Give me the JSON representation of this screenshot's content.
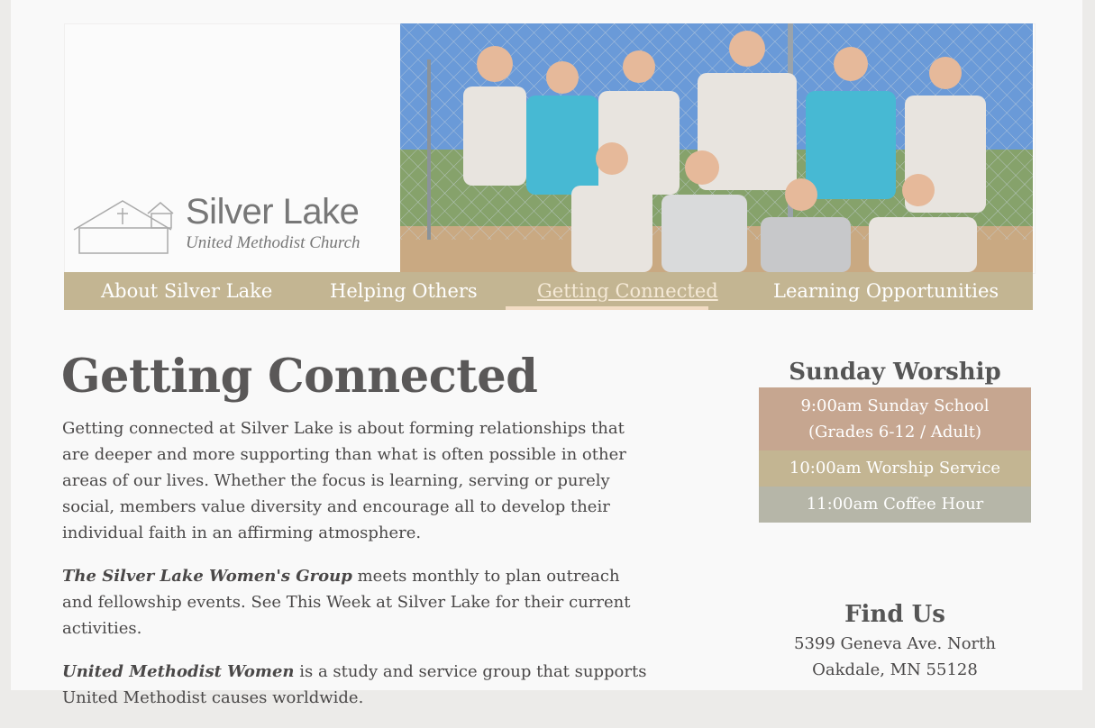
{
  "site": {
    "logo_name": "Silver Lake",
    "logo_sub": "United Methodist Church"
  },
  "nav": {
    "items": [
      {
        "label": "About Silver Lake"
      },
      {
        "label": "Helping Others"
      },
      {
        "label": "Getting Connected"
      },
      {
        "label": "Learning Opportunities"
      }
    ],
    "active_index": 2
  },
  "main": {
    "title": "Getting Connected",
    "intro": "Getting connected at Silver Lake is about forming relationships that are deeper and more supporting than what is often possible in other areas of our lives. Whether the focus is learning, serving or purely social, members value diversity and encourage all to develop their individual faith in an affirming atmosphere.",
    "groups": [
      {
        "name": "The Silver Lake Women's Group",
        "text": " meets monthly to plan outreach and fellowship events. See This Week at Silver Lake for their current activities."
      },
      {
        "name": "United Methodist Women",
        "text": " is a study and service group that supports United Methodist causes worldwide."
      }
    ]
  },
  "sidebar": {
    "worship_title": "Sunday Worship",
    "services": [
      {
        "line1": "9:00am Sunday School",
        "line2": "(Grades 6-12 / Adult)"
      },
      {
        "line1": "10:00am Worship Service"
      },
      {
        "line1": "11:00am Coffee Hour"
      }
    ],
    "find_title": "Find Us",
    "address_line1": "5399 Geneva Ave. North",
    "address_line2": "Oakdale, MN 55128"
  },
  "colors": {
    "nav_bg": "#c3b592",
    "service1": "#c6a690",
    "service2": "#c3b592",
    "service3": "#b6b6a8"
  }
}
